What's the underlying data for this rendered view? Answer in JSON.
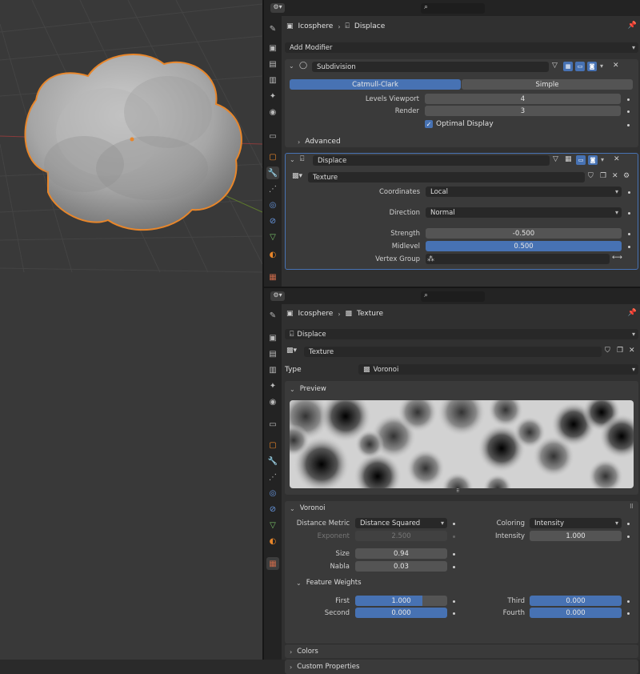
{
  "viewport": {
    "object_name": "Icosphere"
  },
  "top_panel": {
    "breadcrumb": {
      "object": "Icosphere",
      "item": "Displace"
    },
    "add_modifier": "Add Modifier",
    "subdivision": {
      "name": "Subdivision",
      "mode_catmull": "Catmull-Clark",
      "mode_simple": "Simple",
      "levels_viewport_label": "Levels Viewport",
      "levels_viewport_value": "4",
      "render_label": "Render",
      "render_value": "3",
      "optimal_display": "Optimal Display",
      "advanced": "Advanced"
    },
    "displace": {
      "name": "Displace",
      "texture_name": "Texture",
      "coordinates_label": "Coordinates",
      "coordinates_value": "Local",
      "direction_label": "Direction",
      "direction_value": "Normal",
      "strength_label": "Strength",
      "strength_value": "-0.500",
      "midlevel_label": "Midlevel",
      "midlevel_value": "0.500",
      "midlevel_fraction": 0.5,
      "vertex_group_label": "Vertex Group",
      "vertex_group_value": ""
    }
  },
  "bottom_panel": {
    "breadcrumb": {
      "object": "Icosphere",
      "item": "Texture"
    },
    "user_select": "Displace",
    "texture_name": "Texture",
    "type_label": "Type",
    "type_value": "Voronoi",
    "preview_label": "Preview",
    "voronoi_label": "Voronoi",
    "distance_metric_label": "Distance Metric",
    "distance_metric_value": "Distance Squared",
    "exponent_label": "Exponent",
    "exponent_value": "2.500",
    "coloring_label": "Coloring",
    "coloring_value": "Intensity",
    "intensity_label": "Intensity",
    "intensity_value": "1.000",
    "size_label": "Size",
    "size_value": "0.94",
    "nabla_label": "Nabla",
    "nabla_value": "0.03",
    "feature_weights_label": "Feature Weights",
    "first_label": "First",
    "first_value": "1.000",
    "first_fraction": 1.0,
    "second_label": "Second",
    "second_value": "0.000",
    "third_label": "Third",
    "third_value": "0.000",
    "fourth_label": "Fourth",
    "fourth_value": "0.000",
    "colors_label": "Colors",
    "custom_properties_label": "Custom Properties"
  },
  "colors": {
    "accent": "#4772b3",
    "selection_outline": "#e8862a",
    "panel_bg": "#303030",
    "header_bg": "#232323"
  }
}
